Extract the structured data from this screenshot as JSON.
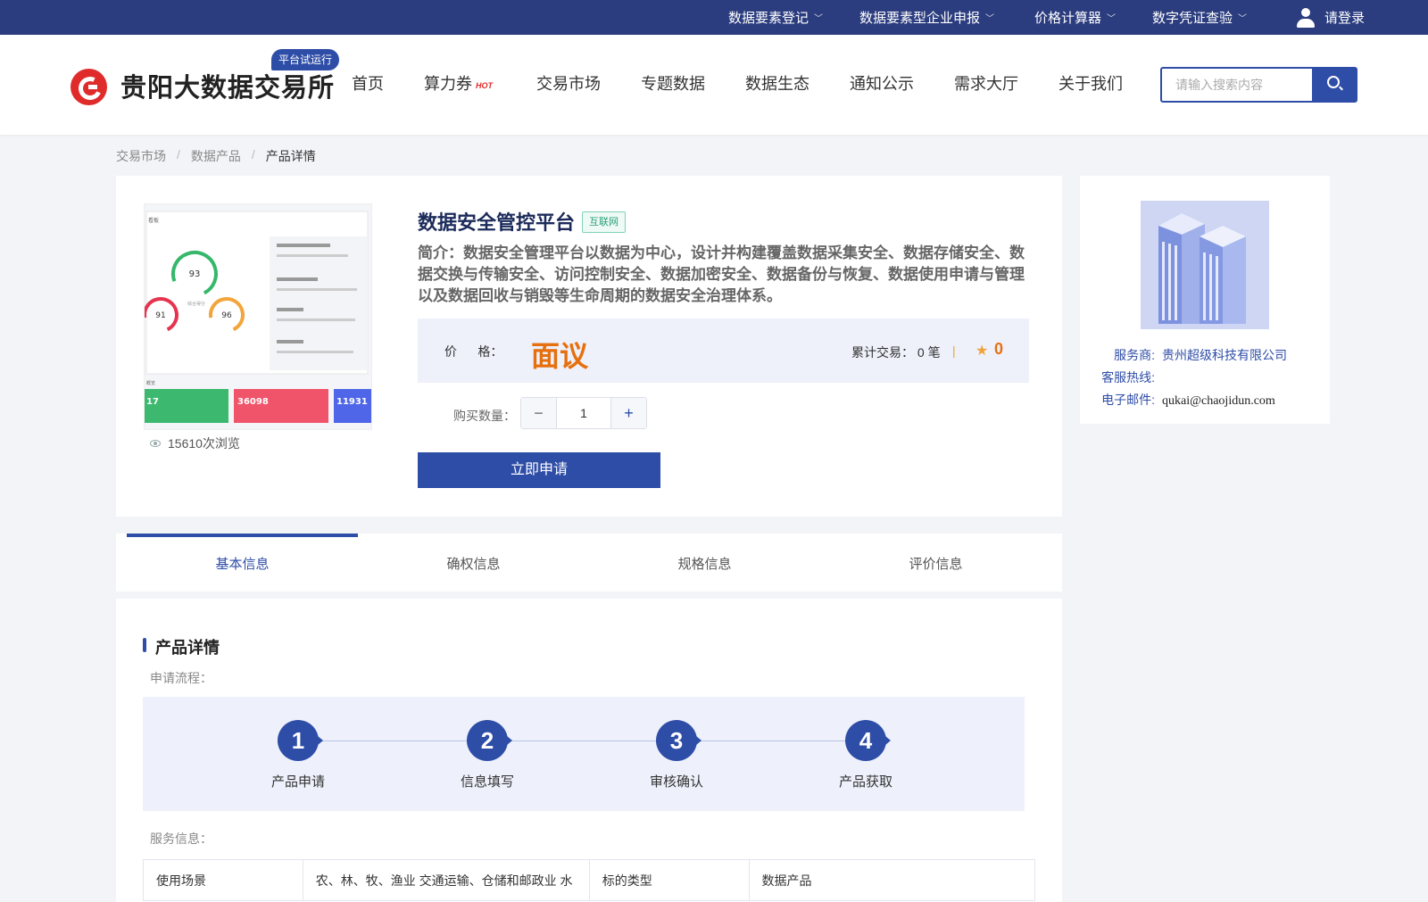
{
  "topbar": {
    "items": [
      {
        "label": "数据要素登记"
      },
      {
        "label": "数据要素型企业申报"
      },
      {
        "label": "价格计算器"
      },
      {
        "label": "数字凭证查验"
      }
    ],
    "login_label": "请登录"
  },
  "header": {
    "logo_text": "贵阳大数据交易所",
    "badge": "平台试运行",
    "nav": [
      "首页",
      "算力券",
      "交易市场",
      "专题数据",
      "数据生态",
      "通知公示",
      "需求大厅",
      "关于我们"
    ],
    "hot_badge": "HOT",
    "search_placeholder": "请输入搜索内容"
  },
  "breadcrumb": [
    "交易市场",
    "数据产品",
    "产品详情"
  ],
  "product": {
    "title": "数据安全管控平台",
    "tag": "互联网",
    "description": "简介：数据安全管理平台以数据为中心，设计并构建覆盖数据采集安全、数据存储安全、数据交换与传输安全、访问控制安全、数据加密安全、数据备份与恢复、数据使用申请与管理以及数据回收与销毁等生命周期的数据安全治理体系。",
    "price_label": "价      格：",
    "price_value": "面议",
    "trade_text": "累计交易： 0 笔",
    "star_count": "0",
    "quantity_label": "购买数量：",
    "quantity": "1",
    "apply_label": "立即申请",
    "views": "15610次浏览",
    "thumbnail": {
      "gauges": [
        "93",
        "91",
        "96"
      ],
      "gauge_caption": "综合得分",
      "metrics": [
        "17",
        "36098",
        "11931"
      ]
    }
  },
  "provider": {
    "rows": [
      {
        "key": "服务商:",
        "value": "贵州超级科技有限公司"
      },
      {
        "key": "客服热线:",
        "value": ""
      },
      {
        "key": "电子邮件:",
        "value": "qukai@chaojidun.com"
      }
    ]
  },
  "tabs": [
    "基本信息",
    "确权信息",
    "规格信息",
    "评价信息"
  ],
  "detail": {
    "heading": "产品详情",
    "flow_label": "申请流程：",
    "steps": [
      {
        "num": "1",
        "label": "产品申请"
      },
      {
        "num": "2",
        "label": "信息填写"
      },
      {
        "num": "3",
        "label": "审核确认"
      },
      {
        "num": "4",
        "label": "产品获取"
      }
    ],
    "service_label": "服务信息：",
    "table": {
      "row1": [
        "使用场景",
        "农、林、牧、渔业 交通运输、仓储和邮政业 水",
        "标的类型",
        "数据产品"
      ]
    }
  },
  "colors": {
    "primary": "#2e4da7",
    "topbar": "#2b3c7f",
    "price": "#e6700f",
    "tag_green": "#2aa07a"
  }
}
